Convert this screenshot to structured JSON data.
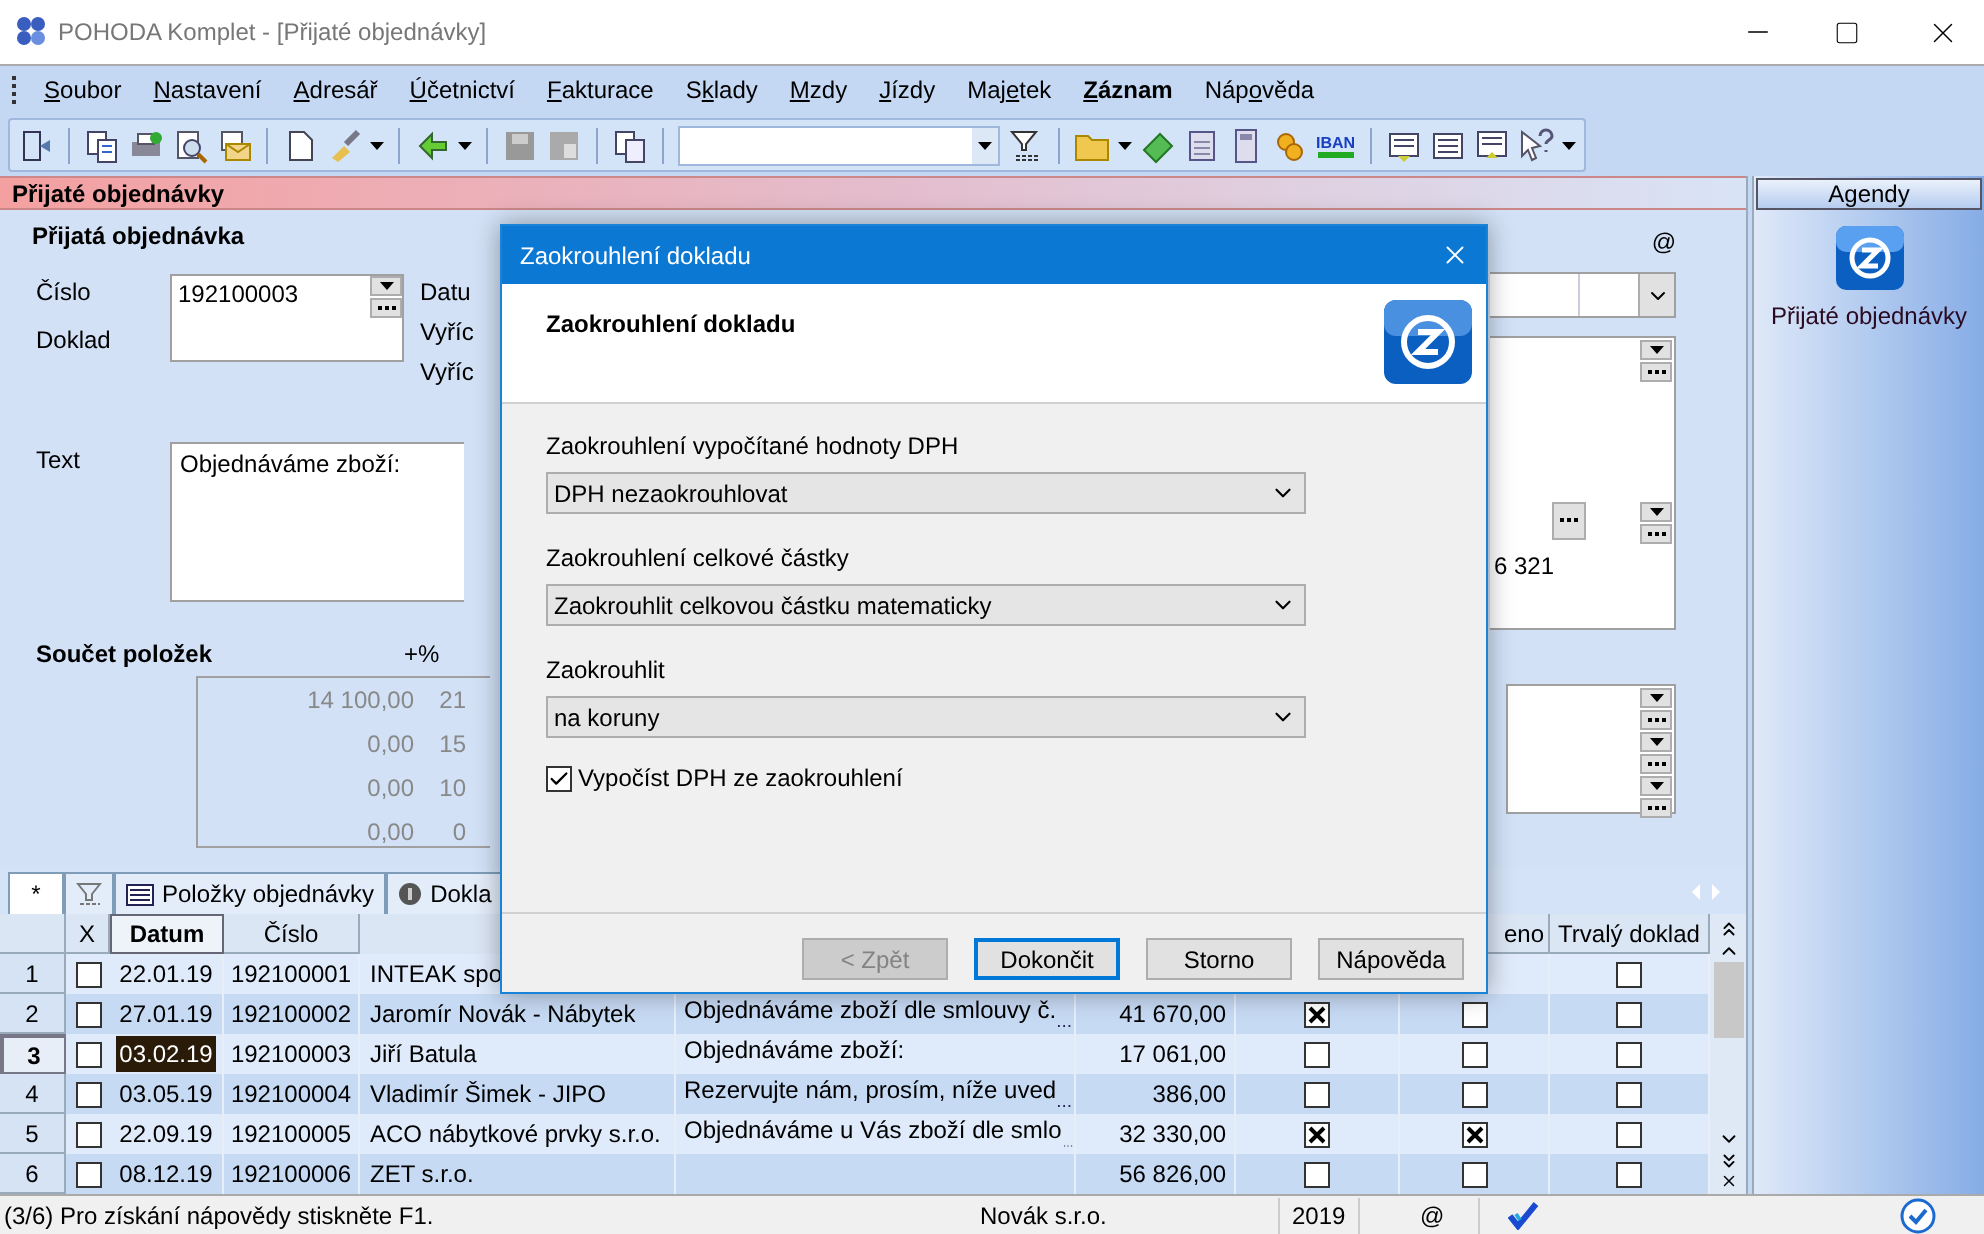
{
  "window": {
    "title": "POHODA Komplet - [Přijaté objednávky]"
  },
  "menu": [
    {
      "key": "S",
      "after": "oubor",
      "bold": false
    },
    {
      "key": "N",
      "after": "astavení",
      "bold": false
    },
    {
      "key": "A",
      "after": "dresář",
      "bold": false
    },
    {
      "key": "Ú",
      "after": "četnictví",
      "bold": false
    },
    {
      "key": "F",
      "after": "akturace",
      "bold": false
    },
    {
      "before": "S",
      "key": "k",
      "after": "lady",
      "bold": false
    },
    {
      "key": "M",
      "after": "zdy",
      "bold": false
    },
    {
      "key": "J",
      "after": "ízdy",
      "bold": false
    },
    {
      "before": "Maj",
      "key": "e",
      "after": "tek",
      "bold": false
    },
    {
      "key": "Z",
      "after": "áznam",
      "bold": true
    },
    {
      "before": "Náp",
      "key": "o",
      "after": "věda",
      "bold": false
    }
  ],
  "toolbar": {
    "iban_label": "IBAN"
  },
  "agenda_header": "Přijaté objednávky",
  "form": {
    "title": "Přijatá objednávka",
    "number_label": "Číslo",
    "document_label": "Doklad",
    "number_value": "192100003",
    "side_labels": [
      "Datu",
      "Vyříc",
      "Vyříc"
    ],
    "text_label": "Text",
    "text_value": "Objednáváme zboží:",
    "totals_label": "Součet položek",
    "rate_label": "+%",
    "totals": [
      {
        "amount": "14 100,00",
        "rate": "21"
      },
      {
        "amount": "0,00",
        "rate": "15"
      },
      {
        "amount": "0,00",
        "rate": "10"
      },
      {
        "amount": "0,00",
        "rate": "0"
      }
    ],
    "email_mark": "@",
    "address_fragment": "6 321"
  },
  "tabs": [
    {
      "kind": "text",
      "label": "*",
      "selected": true
    },
    {
      "kind": "filter",
      "selected": false
    },
    {
      "kind": "list",
      "label": "Položky objednávky",
      "selected": false
    },
    {
      "kind": "info",
      "label": "Dokla",
      "selected": false
    }
  ],
  "table": {
    "columns": [
      {},
      {
        "label": "X",
        "sorted": false
      },
      {
        "label": "Datum",
        "sorted": true
      },
      {
        "label": "Číslo",
        "sorted": false
      },
      {},
      {},
      {},
      {},
      {
        "label": "eno",
        "sorted": false
      },
      {
        "label": "Trvalý doklad",
        "sorted": false
      }
    ],
    "rows": [
      {
        "num": "1",
        "deleted": false,
        "date": "22.01.19",
        "number": "192100001",
        "company": "INTEAK spo",
        "permanent": false,
        "selected": false
      },
      {
        "num": "2",
        "deleted": false,
        "date": "27.01.19",
        "number": "192100002",
        "company": "Jaromír Novák - Nábytek",
        "text": "Objednáváme zboží dle smlouvy č.",
        "truncated": true,
        "amount": "41 670,00",
        "col_1": true,
        "col_2": false,
        "permanent": false,
        "selected": false
      },
      {
        "num": "3",
        "deleted": false,
        "date": "03.02.19",
        "number": "192100003",
        "company": "Jiří Batula",
        "text": "Objednáváme zboží:",
        "truncated": false,
        "amount": "17 061,00",
        "col_1": false,
        "col_2": false,
        "permanent": false,
        "selected": true
      },
      {
        "num": "4",
        "deleted": false,
        "date": "03.05.19",
        "number": "192100004",
        "company": "Vladimír Šimek - JIPO",
        "text": "Rezervujte nám, prosím, níže uved",
        "truncated": true,
        "amount": "386,00",
        "col_1": false,
        "col_2": false,
        "permanent": false,
        "selected": false
      },
      {
        "num": "5",
        "deleted": false,
        "date": "22.09.19",
        "number": "192100005",
        "company": "ACO nábytkové prvky s.r.o.",
        "text": "Objednáváme u Vás zboží dle smlo",
        "truncated": true,
        "amount": "32 330,00",
        "col_1": true,
        "col_2": true,
        "permanent": false,
        "selected": false
      },
      {
        "num": "6",
        "deleted": false,
        "date": "08.12.19",
        "number": "192100006",
        "company": "ZET s.r.o.",
        "amount": "56 826,00",
        "col_1": false,
        "col_2": false,
        "permanent": false,
        "selected": false
      }
    ]
  },
  "agendy": {
    "header": "Agendy",
    "items": [
      {
        "label": "Přijaté objednávky",
        "selected": false
      }
    ]
  },
  "status_bar": {
    "message": "(3/6) Pro získání nápovědy stiskněte F1.",
    "company": "Novák s.r.o.",
    "year": "2019",
    "email": "@"
  },
  "dialog": {
    "title": "Zaokrouhlení dokladu",
    "header": "Zaokrouhlení dokladu",
    "fields": [
      {
        "label": "Zaokrouhlení vypočítané hodnoty DPH",
        "value": "DPH nezaokrouhlovat"
      },
      {
        "label": "Zaokrouhlení celkové částky",
        "value": "Zaokrouhlit celkovou částku matematicky"
      },
      {
        "label": "Zaokrouhlit",
        "value": "na koruny"
      }
    ],
    "checkbox": {
      "label": "Vypočíst DPH ze zaokrouhlení",
      "checked": true
    },
    "buttons": [
      {
        "label": "< Zpět",
        "disabled": true,
        "default": false
      },
      {
        "label": "Dokončit",
        "disabled": false,
        "default": true
      },
      {
        "label": "Storno",
        "disabled": false,
        "default": false
      },
      {
        "label": "Nápověda",
        "disabled": false,
        "default": false
      }
    ]
  }
}
